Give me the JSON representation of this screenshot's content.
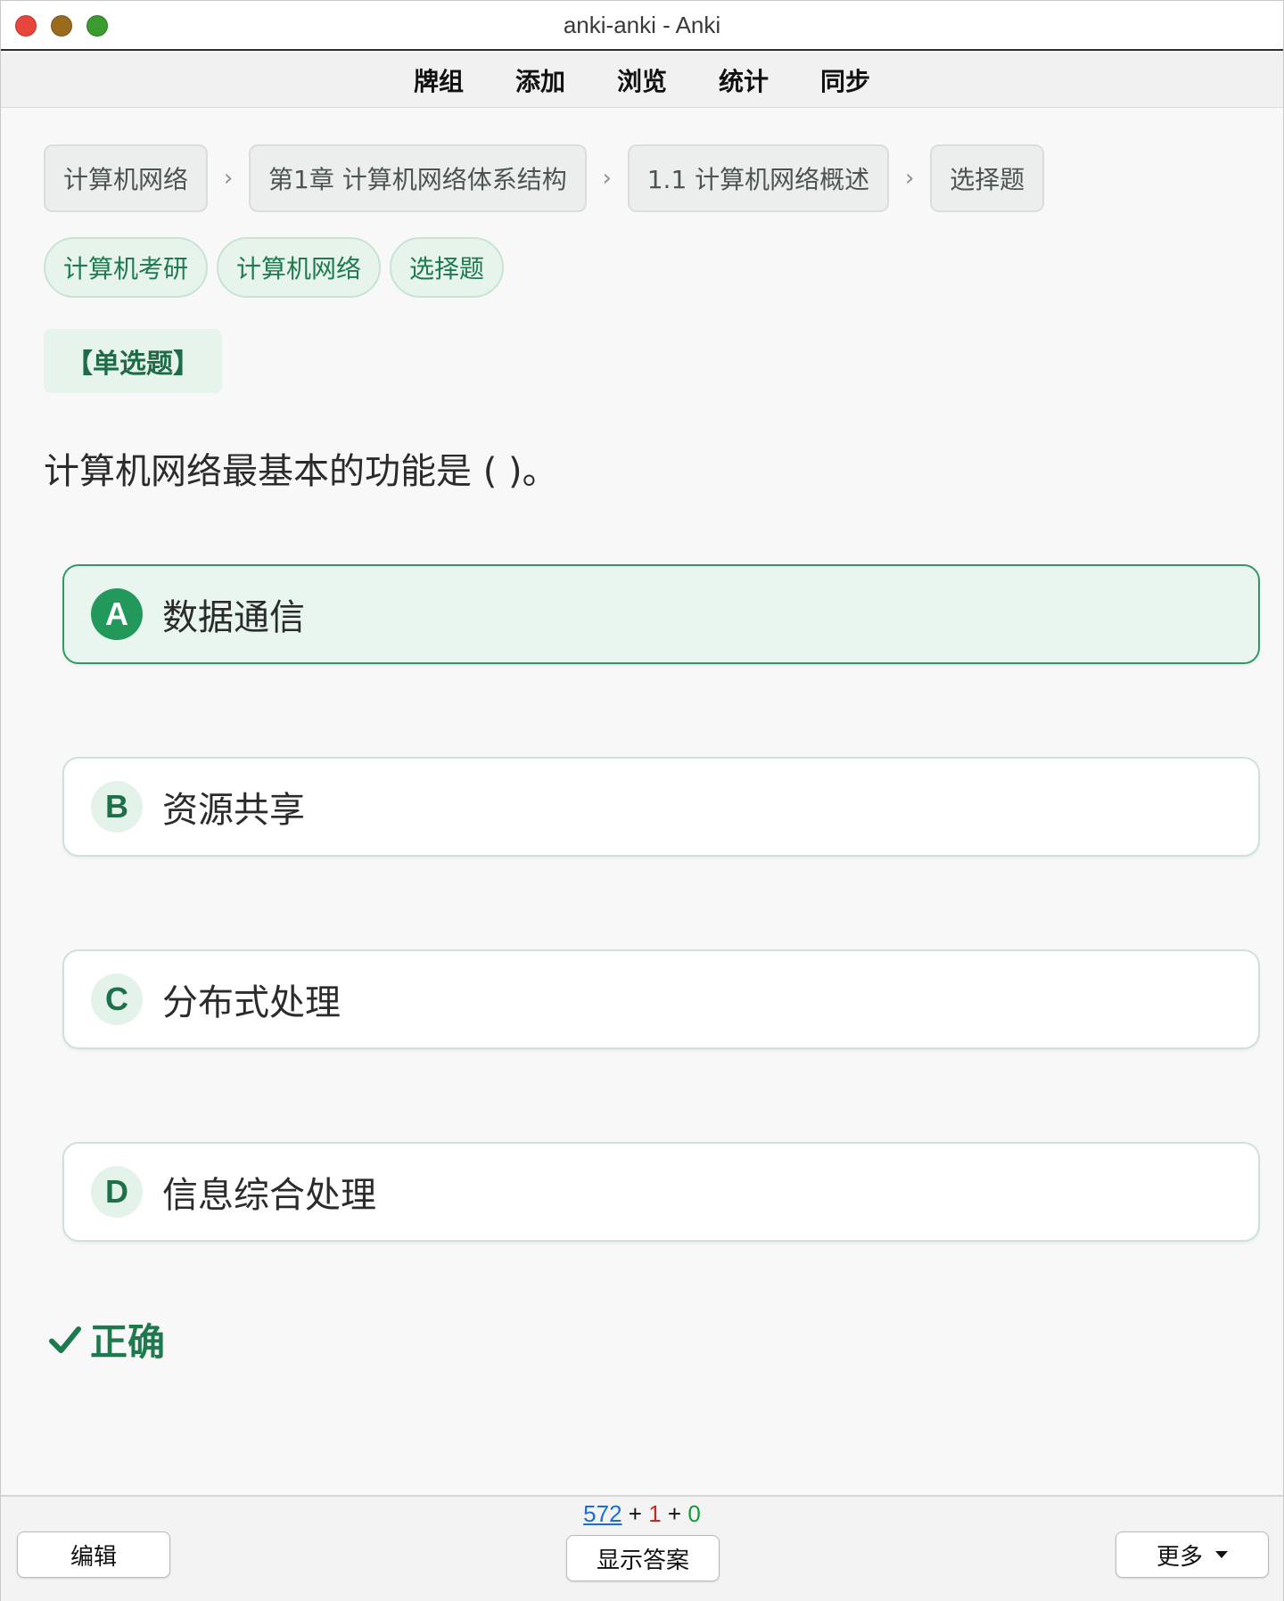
{
  "window": {
    "title": "anki-anki - Anki"
  },
  "menu": {
    "items": [
      "牌组",
      "添加",
      "浏览",
      "统计",
      "同步"
    ]
  },
  "breadcrumbs": [
    "计算机网络",
    "第1章 计算机网络体系结构",
    "1.1 计算机网络概述",
    "选择题"
  ],
  "breadcrumb_separator": "›",
  "tags": [
    "计算机考研",
    "计算机网络",
    "选择题"
  ],
  "question_type": "【单选题】",
  "question": "计算机网络最基本的功能是 ( )。",
  "options": [
    {
      "letter": "A",
      "text": "数据通信",
      "selected": true
    },
    {
      "letter": "B",
      "text": "资源共享",
      "selected": false
    },
    {
      "letter": "C",
      "text": "分布式处理",
      "selected": false
    },
    {
      "letter": "D",
      "text": "信息综合处理",
      "selected": false
    }
  ],
  "result": {
    "text": "正确",
    "icon": "checkmark-icon",
    "color": "#1e7a4e"
  },
  "bottom": {
    "edit_label": "编辑",
    "show_answer_label": "显示答案",
    "more_label": "更多",
    "counts": {
      "new": "572",
      "plus1": "+",
      "learn": "1",
      "plus2": "+",
      "review": "0"
    }
  },
  "colors": {
    "accent": "#23985b",
    "new": "#1b6ed6",
    "learn": "#c8281e",
    "review": "#179a3c"
  }
}
